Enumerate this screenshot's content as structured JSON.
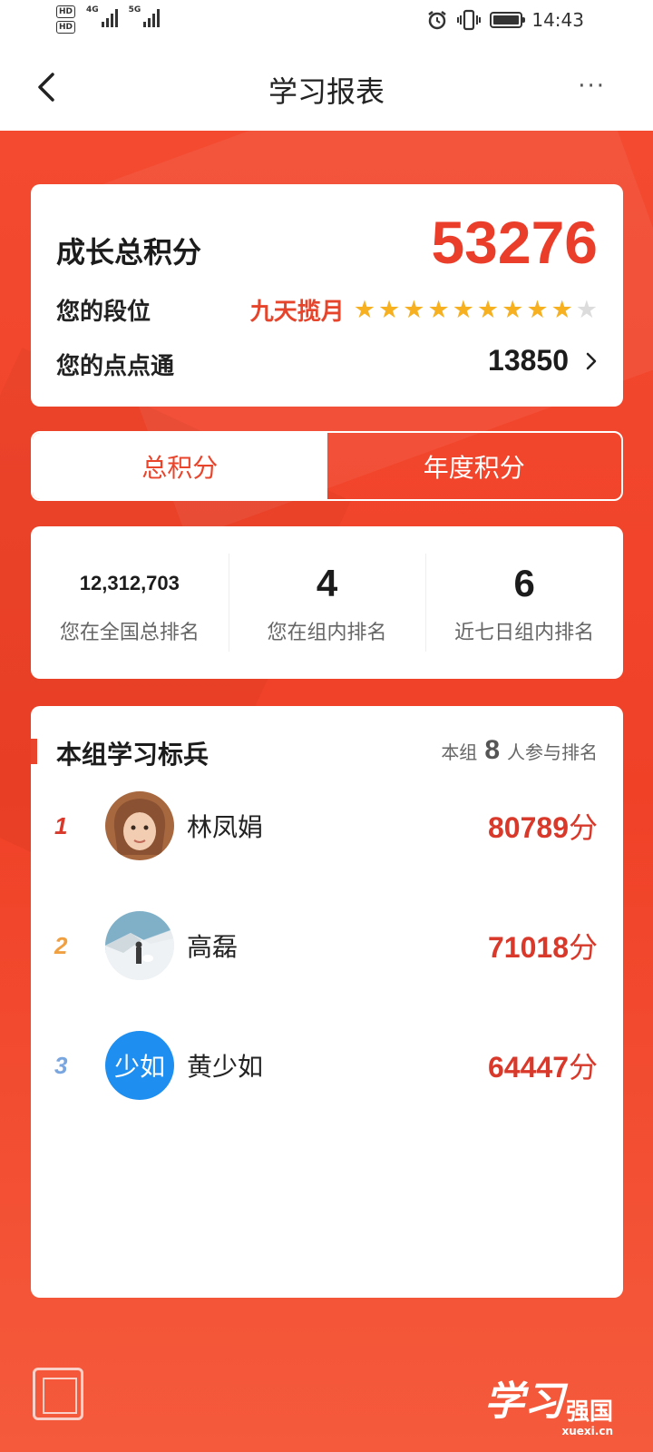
{
  "status_bar": {
    "hd1": "HD",
    "hd2": "HD",
    "net1": "4G",
    "net2": "5G",
    "time": "14:43"
  },
  "nav": {
    "title": "学习报表",
    "more": "···"
  },
  "score": {
    "label": "成长总积分",
    "value": "53276",
    "rank_label": "您的段位",
    "rank_name": "九天揽月",
    "stars_filled": 9,
    "stars_total": 10,
    "star_color": "#f6b020",
    "coin_label": "您的点点通",
    "coin_value": "13850"
  },
  "tabs": [
    {
      "label": "总积分",
      "active": true
    },
    {
      "label": "年度积分",
      "active": false
    }
  ],
  "ranks": [
    {
      "value": "12,312,703",
      "label": "您在全国总排名"
    },
    {
      "value": "4",
      "label": "您在组内排名"
    },
    {
      "value": "6",
      "label": "近七日组内排名"
    }
  ],
  "leaders": {
    "title": "本组学习标兵",
    "count_prefix": "本组",
    "count": "8",
    "count_suffix": "人参与排名",
    "rows": [
      {
        "pos": "1",
        "pos_color": "#d8392a",
        "name": "林凤娟",
        "score": "80789",
        "unit": "分",
        "avatar_text": ""
      },
      {
        "pos": "2",
        "pos_color": "#f0a040",
        "name": "高磊",
        "score": "71018",
        "unit": "分",
        "avatar_text": ""
      },
      {
        "pos": "3",
        "pos_color": "#7aa6e0",
        "name": "黄少如",
        "score": "64447",
        "unit": "分",
        "avatar_text": "少如"
      }
    ]
  },
  "footer": {
    "brand_script": "学习",
    "brand_name": "强国",
    "brand_url": "xuexi.cn"
  },
  "colors": {
    "accent": "#e8452c",
    "background": "#f1462d"
  }
}
